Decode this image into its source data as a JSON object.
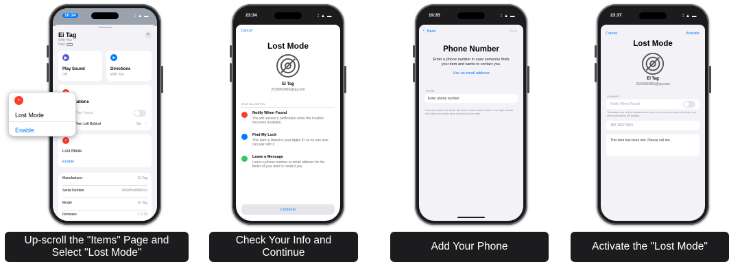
{
  "steps": [
    {
      "caption": "Up-scroll the \"Items\" Page and Select \"Lost Mode\""
    },
    {
      "caption": "Check Your Info and Continue"
    },
    {
      "caption": "Add Your Phone"
    },
    {
      "caption": "Activate the \"Lost Mode\""
    }
  ],
  "phone1": {
    "time": "10:34",
    "status_right": "∶ ▲ ▬",
    "item_name": "Ei Tag",
    "with_you": "With You",
    "now": "Now",
    "play_sound": {
      "title": "Play Sound",
      "sub": "Off"
    },
    "directions": {
      "title": "Directions",
      "sub": "With You"
    },
    "notifications_label": "ications",
    "when_found": "When Found",
    "left_behind": "When Left Behind",
    "left_behind_value": "On",
    "lost_mode_label": "Lost Mode",
    "enable_label": "Enable",
    "popup": {
      "title": "Lost Mode",
      "enable": "Enable"
    },
    "details": [
      {
        "label": "Manufacturer",
        "value": "Ei Tag"
      },
      {
        "label": "Serial Number",
        "value": "9e8df5e988b67e"
      },
      {
        "label": "Model",
        "value": "Ei Tag"
      },
      {
        "label": "Firmware",
        "value": "1.7.33"
      }
    ]
  },
  "phone2": {
    "time": "23:34",
    "status_right": "∶ ▲ ▬",
    "cancel": "Cancel",
    "title": "Lost Mode",
    "item_name": "Ei Tag",
    "email": "2530060865@qq.com",
    "section": "WHAT WILL HAPPEN",
    "features": [
      {
        "title": "Notify When Found",
        "desc": "You will receive a notification when the location becomes available.",
        "color": "#ff3b30"
      },
      {
        "title": "Find My Lock",
        "desc": "This item is linked to your Apple ID so no one else can pair with it.",
        "color": "#007aff"
      },
      {
        "title": "Leave a Message",
        "desc": "Leave a phone number or email address for the finder of your item to contact you.",
        "color": "#34c759"
      }
    ],
    "continue": "Continue"
  },
  "phone3": {
    "time": "19:35",
    "status_right": "∶ ▲ ▬",
    "back": "Back",
    "next": "Next",
    "title": "Phone Number",
    "desc": "Enter a phone number in case someone finds your item and wants to contact you.",
    "email_link": "Use an email address",
    "field_label": "PHONE",
    "placeholder": "Enter phone number",
    "footnote": "Once you enable Lost Mode, this phone number will be visible on an Apple website that others can access when they find your lost item."
  },
  "phone4": {
    "time": "23:37",
    "status_right": "∶ ▲ ▬",
    "cancel": "Cancel",
    "activate": "Activate",
    "title": "Lost Mode",
    "item_name": "Ei Tag",
    "email": "2530060865@qq.com",
    "summary_label": "SUMMARY",
    "notify": "Notify When Found",
    "notify_note": "This feature can only be enabled when you're not in close proximity to this item, and when notifications are enabled.",
    "phone_value": "182 1637 6831",
    "message": "This item has been lost. Please call me."
  },
  "colors": {
    "accent": "#007aff",
    "danger": "#ff3b30",
    "green": "#34c759"
  }
}
